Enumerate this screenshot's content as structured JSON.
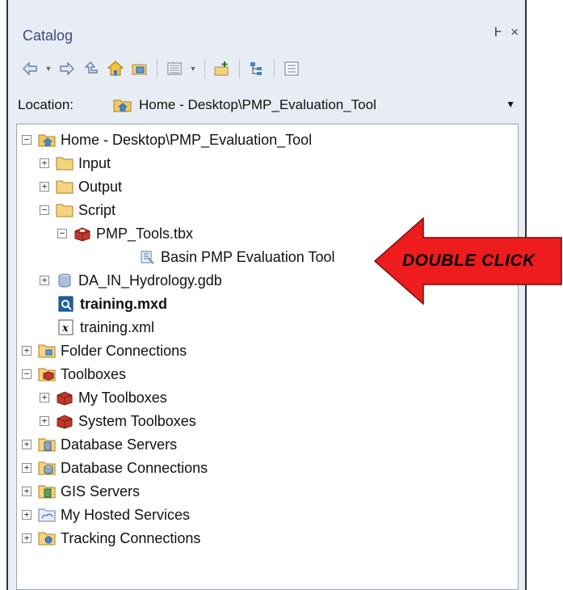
{
  "window": {
    "title": "Catalog",
    "pin": "Ͱ",
    "close": "×"
  },
  "toolbar": {
    "icons": [
      "back-arrow-icon",
      "forward-arrow-icon",
      "up-one-level-icon",
      "home-icon",
      "connect-folder-icon",
      "view-options-icon",
      "new-toolbox-icon",
      "tree-view-icon",
      "details-view-icon"
    ]
  },
  "location": {
    "label": "Location:",
    "value": "Home - Desktop\\PMP_Evaluation_Tool"
  },
  "tree": {
    "items": [
      {
        "label": "Home - Desktop\\PMP_Evaluation_Tool",
        "expander": "−",
        "icon": "home-folder-icon"
      },
      {
        "label": "Input",
        "expander": "+",
        "icon": "folder-icon"
      },
      {
        "label": "Output",
        "expander": "+",
        "icon": "folder-icon"
      },
      {
        "label": "Script",
        "expander": "−",
        "icon": "folder-icon"
      },
      {
        "label": "PMP_Tools.tbx",
        "expander": "−",
        "icon": "toolbox-icon"
      },
      {
        "label": "Basin PMP Evaluation Tool",
        "expander": "",
        "icon": "script-tool-icon"
      },
      {
        "label": "DA_IN_Hydrology.gdb",
        "expander": "+",
        "icon": "geodatabase-icon"
      },
      {
        "label": "training.mxd",
        "expander": "",
        "icon": "map-document-icon"
      },
      {
        "label": "training.xml",
        "expander": "",
        "icon": "xml-file-icon"
      },
      {
        "label": "Folder Connections",
        "expander": "+",
        "icon": "folder-connections-icon"
      },
      {
        "label": "Toolboxes",
        "expander": "−",
        "icon": "toolboxes-icon"
      },
      {
        "label": "My Toolboxes",
        "expander": "+",
        "icon": "toolbox-icon"
      },
      {
        "label": "System Toolboxes",
        "expander": "+",
        "icon": "toolbox-icon"
      },
      {
        "label": "Database Servers",
        "expander": "+",
        "icon": "database-servers-icon"
      },
      {
        "label": "Database Connections",
        "expander": "+",
        "icon": "database-connections-icon"
      },
      {
        "label": "GIS Servers",
        "expander": "+",
        "icon": "gis-servers-icon"
      },
      {
        "label": "My Hosted Services",
        "expander": "+",
        "icon": "hosted-services-icon"
      },
      {
        "label": "Tracking Connections",
        "expander": "+",
        "icon": "tracking-connections-icon"
      }
    ]
  },
  "annotation": {
    "text": "DOUBLE CLICK",
    "color": "#ee1c1c"
  }
}
